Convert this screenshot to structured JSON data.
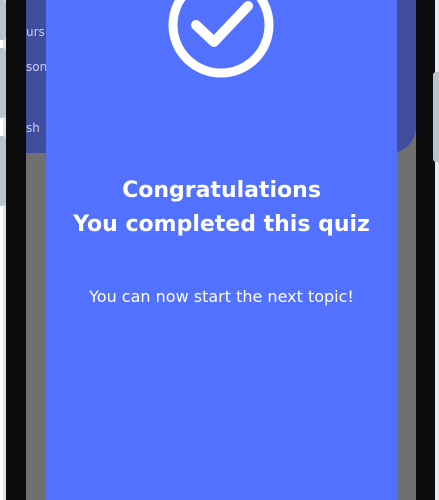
{
  "background_screen": {
    "partial_labels": [
      "urs",
      "son",
      "sh"
    ]
  },
  "dialog": {
    "icon": "checkmark-circle-icon",
    "title_line1": "Congratulations",
    "title_line2": "You completed this quiz",
    "message": "You can now start the next topic!"
  },
  "colors": {
    "dialog_background": "#5271ff",
    "background_header": "#3f4d9c",
    "overlay": "#707070",
    "text": "#ffffff"
  }
}
